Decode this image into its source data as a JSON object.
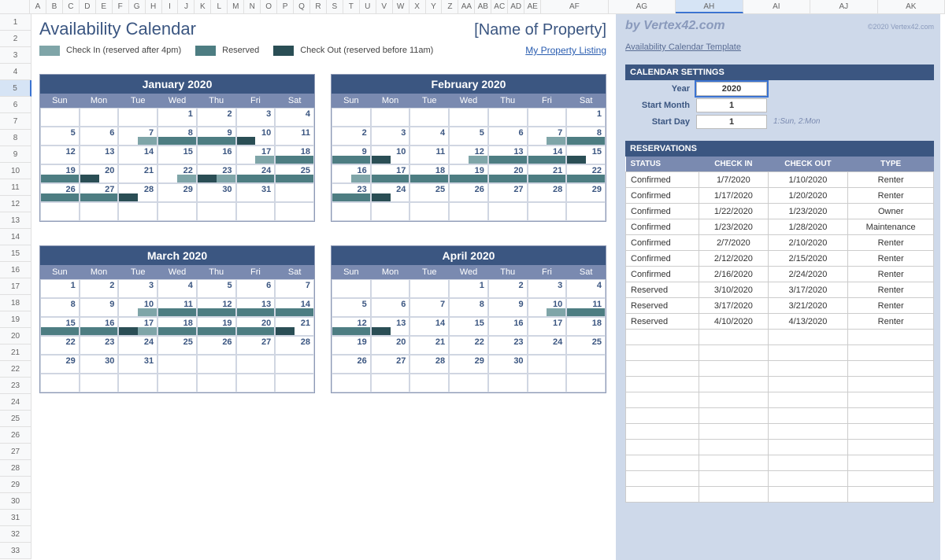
{
  "title": "Availability Calendar",
  "property": "[Name of Property]",
  "legend": {
    "checkin": "Check In (reserved after 4pm)",
    "reserved": "Reserved",
    "checkout": "Check Out (reserved before 11am)"
  },
  "listing_link": "My Property Listing",
  "brand": "by Vertex42.com",
  "copyright": "©2020 Vertex42.com",
  "template_link": "Availability Calendar Template",
  "dow": [
    "Sun",
    "Mon",
    "Tue",
    "Wed",
    "Thu",
    "Fri",
    "Sat"
  ],
  "col_letters": [
    "A",
    "B",
    "C",
    "D",
    "E",
    "F",
    "G",
    "H",
    "I",
    "J",
    "K",
    "L",
    "M",
    "N",
    "O",
    "P",
    "Q",
    "R",
    "S",
    "T",
    "U",
    "V",
    "W",
    "X",
    "Y",
    "Z",
    "AA",
    "AB",
    "AC",
    "AD",
    "AE",
    "AF",
    "AG",
    "AH",
    "AI",
    "AJ",
    "AK"
  ],
  "months": [
    {
      "title": "January 2020",
      "weeks": [
        [
          null,
          null,
          null,
          {
            "n": 1
          },
          {
            "n": 2
          },
          {
            "n": 3
          },
          {
            "n": 4
          }
        ],
        [
          {
            "n": 5
          },
          {
            "n": 6
          },
          {
            "n": 7,
            "s": [
              "",
              "in"
            ]
          },
          {
            "n": 8,
            "s": [
              "res",
              "res"
            ]
          },
          {
            "n": 9,
            "s": [
              "res",
              "res"
            ]
          },
          {
            "n": 10,
            "s": [
              "out",
              ""
            ]
          },
          {
            "n": 11
          }
        ],
        [
          {
            "n": 12
          },
          {
            "n": 13
          },
          {
            "n": 14
          },
          {
            "n": 15
          },
          {
            "n": 16
          },
          {
            "n": 17,
            "s": [
              "",
              "in"
            ]
          },
          {
            "n": 18,
            "s": [
              "res",
              "res"
            ]
          }
        ],
        [
          {
            "n": 19,
            "s": [
              "res",
              "res"
            ]
          },
          {
            "n": 20,
            "s": [
              "out",
              ""
            ]
          },
          {
            "n": 21
          },
          {
            "n": 22,
            "s": [
              "",
              "in"
            ]
          },
          {
            "n": 23,
            "s": [
              "out",
              "in"
            ]
          },
          {
            "n": 24,
            "s": [
              "res",
              "res"
            ]
          },
          {
            "n": 25,
            "s": [
              "res",
              "res"
            ]
          }
        ],
        [
          {
            "n": 26,
            "s": [
              "res",
              "res"
            ]
          },
          {
            "n": 27,
            "s": [
              "res",
              "res"
            ]
          },
          {
            "n": 28,
            "s": [
              "out",
              ""
            ]
          },
          {
            "n": 29
          },
          {
            "n": 30
          },
          {
            "n": 31
          },
          null
        ],
        [
          null,
          null,
          null,
          null,
          null,
          null,
          null
        ]
      ]
    },
    {
      "title": "February 2020",
      "weeks": [
        [
          null,
          null,
          null,
          null,
          null,
          null,
          {
            "n": 1
          }
        ],
        [
          {
            "n": 2
          },
          {
            "n": 3
          },
          {
            "n": 4
          },
          {
            "n": 5
          },
          {
            "n": 6
          },
          {
            "n": 7,
            "s": [
              "",
              "in"
            ]
          },
          {
            "n": 8,
            "s": [
              "res",
              "res"
            ]
          }
        ],
        [
          {
            "n": 9,
            "s": [
              "res",
              "res"
            ]
          },
          {
            "n": 10,
            "s": [
              "out",
              ""
            ]
          },
          {
            "n": 11
          },
          {
            "n": 12,
            "s": [
              "",
              "in"
            ]
          },
          {
            "n": 13,
            "s": [
              "res",
              "res"
            ]
          },
          {
            "n": 14,
            "s": [
              "res",
              "res"
            ]
          },
          {
            "n": 15,
            "s": [
              "out",
              ""
            ]
          }
        ],
        [
          {
            "n": 16,
            "s": [
              "",
              "in"
            ]
          },
          {
            "n": 17,
            "s": [
              "res",
              "res"
            ]
          },
          {
            "n": 18,
            "s": [
              "res",
              "res"
            ]
          },
          {
            "n": 19,
            "s": [
              "res",
              "res"
            ]
          },
          {
            "n": 20,
            "s": [
              "res",
              "res"
            ]
          },
          {
            "n": 21,
            "s": [
              "res",
              "res"
            ]
          },
          {
            "n": 22,
            "s": [
              "res",
              "res"
            ]
          }
        ],
        [
          {
            "n": 23,
            "s": [
              "res",
              "res"
            ]
          },
          {
            "n": 24,
            "s": [
              "out",
              ""
            ]
          },
          {
            "n": 25
          },
          {
            "n": 26
          },
          {
            "n": 27
          },
          {
            "n": 28
          },
          {
            "n": 29
          }
        ],
        [
          null,
          null,
          null,
          null,
          null,
          null,
          null
        ]
      ]
    },
    {
      "title": "March 2020",
      "weeks": [
        [
          {
            "n": 1
          },
          {
            "n": 2
          },
          {
            "n": 3
          },
          {
            "n": 4
          },
          {
            "n": 5
          },
          {
            "n": 6
          },
          {
            "n": 7
          }
        ],
        [
          {
            "n": 8
          },
          {
            "n": 9
          },
          {
            "n": 10,
            "s": [
              "",
              "in"
            ]
          },
          {
            "n": 11,
            "s": [
              "res",
              "res"
            ]
          },
          {
            "n": 12,
            "s": [
              "res",
              "res"
            ]
          },
          {
            "n": 13,
            "s": [
              "res",
              "res"
            ]
          },
          {
            "n": 14,
            "s": [
              "res",
              "res"
            ]
          }
        ],
        [
          {
            "n": 15,
            "s": [
              "res",
              "res"
            ]
          },
          {
            "n": 16,
            "s": [
              "res",
              "res"
            ]
          },
          {
            "n": 17,
            "s": [
              "out",
              "in"
            ]
          },
          {
            "n": 18,
            "s": [
              "res",
              "res"
            ]
          },
          {
            "n": 19,
            "s": [
              "res",
              "res"
            ]
          },
          {
            "n": 20,
            "s": [
              "res",
              "res"
            ]
          },
          {
            "n": 21,
            "s": [
              "out",
              ""
            ]
          }
        ],
        [
          {
            "n": 22
          },
          {
            "n": 23
          },
          {
            "n": 24
          },
          {
            "n": 25
          },
          {
            "n": 26
          },
          {
            "n": 27
          },
          {
            "n": 28
          }
        ],
        [
          {
            "n": 29
          },
          {
            "n": 30
          },
          {
            "n": 31
          },
          null,
          null,
          null,
          null
        ],
        [
          null,
          null,
          null,
          null,
          null,
          null,
          null
        ]
      ]
    },
    {
      "title": "April 2020",
      "weeks": [
        [
          null,
          null,
          null,
          {
            "n": 1
          },
          {
            "n": 2
          },
          {
            "n": 3
          },
          {
            "n": 4
          }
        ],
        [
          {
            "n": 5
          },
          {
            "n": 6
          },
          {
            "n": 7
          },
          {
            "n": 8
          },
          {
            "n": 9
          },
          {
            "n": 10,
            "s": [
              "",
              "in"
            ]
          },
          {
            "n": 11,
            "s": [
              "res",
              "res"
            ]
          }
        ],
        [
          {
            "n": 12,
            "s": [
              "res",
              "res"
            ]
          },
          {
            "n": 13,
            "s": [
              "out",
              ""
            ]
          },
          {
            "n": 14
          },
          {
            "n": 15
          },
          {
            "n": 16
          },
          {
            "n": 17
          },
          {
            "n": 18
          }
        ],
        [
          {
            "n": 19
          },
          {
            "n": 20
          },
          {
            "n": 21
          },
          {
            "n": 22
          },
          {
            "n": 23
          },
          {
            "n": 24
          },
          {
            "n": 25
          }
        ],
        [
          {
            "n": 26
          },
          {
            "n": 27
          },
          {
            "n": 28
          },
          {
            "n": 29
          },
          {
            "n": 30
          },
          null,
          null
        ],
        [
          null,
          null,
          null,
          null,
          null,
          null,
          null
        ]
      ]
    }
  ],
  "settings": {
    "header": "CALENDAR SETTINGS",
    "year_lbl": "Year",
    "year_val": "2020",
    "start_month_lbl": "Start Month",
    "start_month_val": "1",
    "start_day_lbl": "Start Day",
    "start_day_val": "1",
    "start_day_note": "1:Sun, 2:Mon"
  },
  "reservations": {
    "header": "RESERVATIONS",
    "cols": [
      "STATUS",
      "CHECK IN",
      "CHECK OUT",
      "TYPE"
    ],
    "rows": [
      [
        "Confirmed",
        "1/7/2020",
        "1/10/2020",
        "Renter"
      ],
      [
        "Confirmed",
        "1/17/2020",
        "1/20/2020",
        "Renter"
      ],
      [
        "Confirmed",
        "1/22/2020",
        "1/23/2020",
        "Owner"
      ],
      [
        "Confirmed",
        "1/23/2020",
        "1/28/2020",
        "Maintenance"
      ],
      [
        "Confirmed",
        "2/7/2020",
        "2/10/2020",
        "Renter"
      ],
      [
        "Confirmed",
        "2/12/2020",
        "2/15/2020",
        "Renter"
      ],
      [
        "Confirmed",
        "2/16/2020",
        "2/24/2020",
        "Renter"
      ],
      [
        "Reserved",
        "3/10/2020",
        "3/17/2020",
        "Renter"
      ],
      [
        "Reserved",
        "3/17/2020",
        "3/21/2020",
        "Renter"
      ],
      [
        "Reserved",
        "4/10/2020",
        "4/13/2020",
        "Renter"
      ]
    ],
    "empty_rows": 11
  }
}
